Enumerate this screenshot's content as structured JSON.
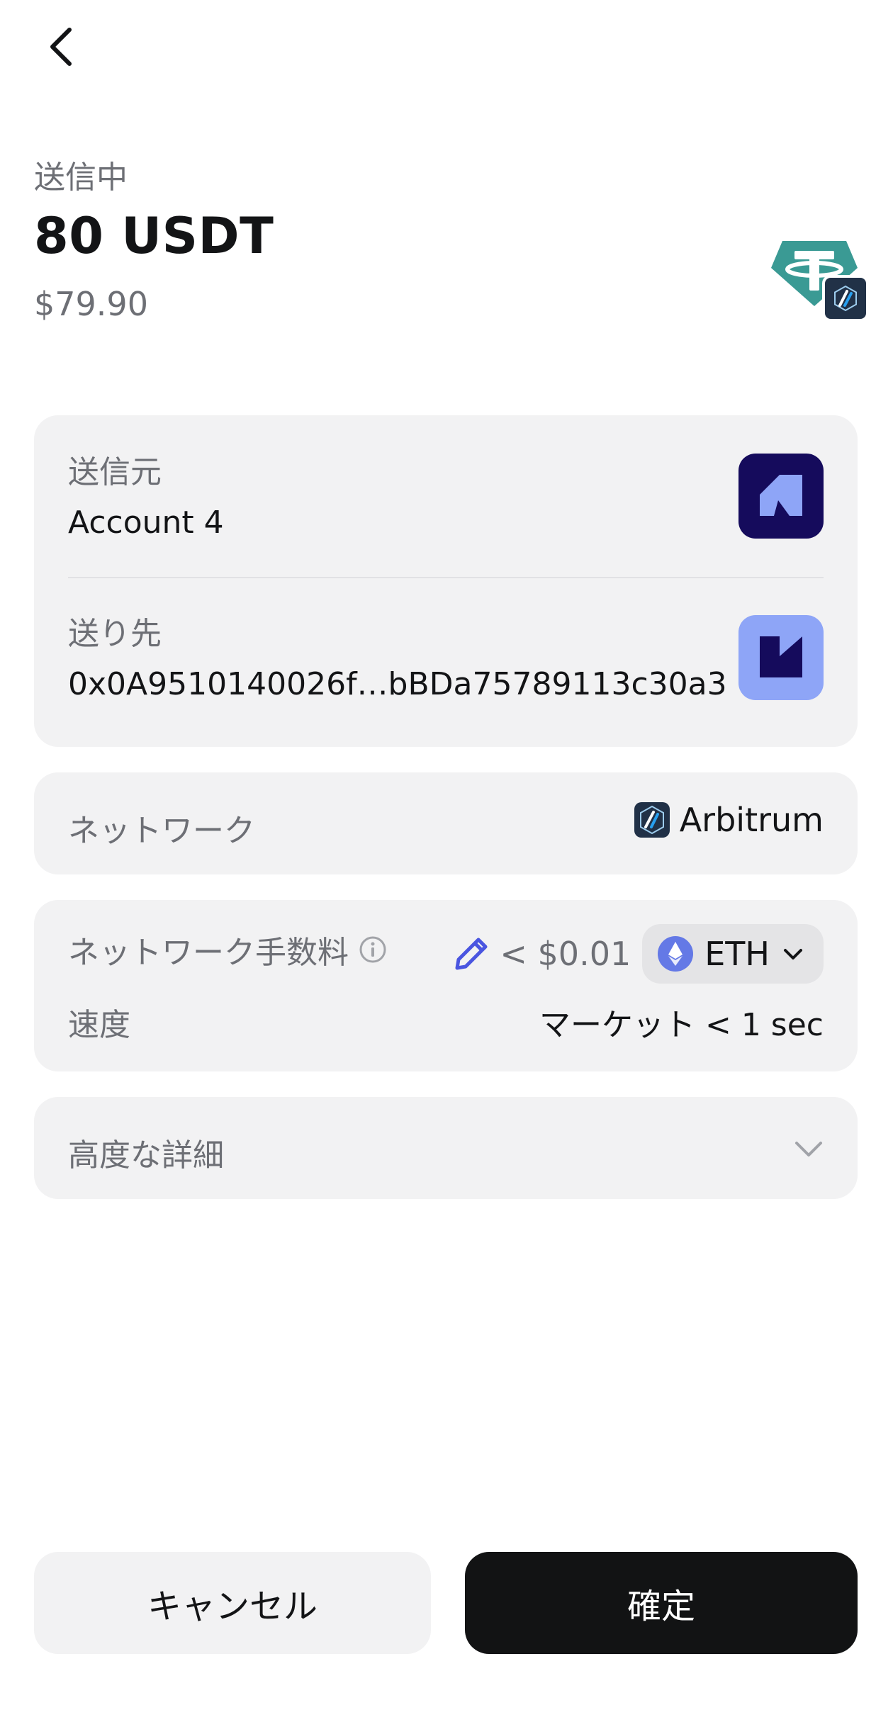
{
  "header": {
    "back_icon": "chevron-left-icon",
    "status_label": "送信中",
    "amount": "80 USDT",
    "fiat_value": "$79.90",
    "token_icon": "tether-usdt-icon",
    "network_badge_icon": "arbitrum-icon"
  },
  "parties": {
    "from_label": "送信元",
    "from_value": "Account 4",
    "from_avatar_icon": "account-avatar-icon",
    "to_label": "送り先",
    "to_value": "0x0A9510140026f…bBDa75789113c30a3",
    "to_avatar_icon": "recipient-avatar-icon"
  },
  "network": {
    "label": "ネットワーク",
    "value": "Arbitrum",
    "icon": "arbitrum-icon"
  },
  "fee": {
    "label": "ネットワーク手数料",
    "info_icon": "info-icon",
    "edit_icon": "pencil-icon",
    "value": "< $0.01",
    "token_chip": "ETH",
    "token_icon": "ethereum-icon",
    "dropdown_icon": "chevron-down-icon",
    "speed_label": "速度",
    "speed_value": "マーケット < 1 sec"
  },
  "advanced": {
    "label": "高度な詳細",
    "icon": "chevron-down-icon"
  },
  "actions": {
    "cancel_label": "キャンセル",
    "confirm_label": "確定"
  },
  "colors": {
    "card_bg": "#f2f2f3",
    "text_primary": "#131416",
    "text_secondary": "#6d6f75",
    "confirm_bg": "#121314",
    "tether": "#3a9a94",
    "arbitrum": "#213147",
    "avatar_from_bg": "#150b5c",
    "avatar_to_bg": "#8ea5f7",
    "pencil": "#4a55e0",
    "eth": "#6479e6"
  }
}
